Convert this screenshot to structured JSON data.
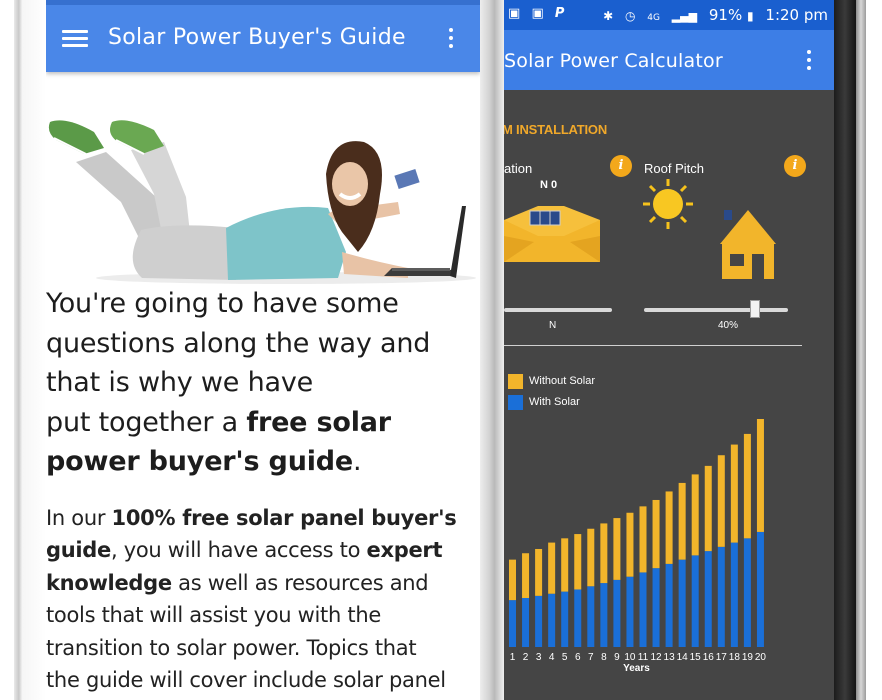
{
  "left_app": {
    "title": "Solar Power Buyer's Guide",
    "lead": {
      "line1": "You're going to have some",
      "line2": "questions along the way and",
      "line3": "that is why we have",
      "line4_pre": "put together a ",
      "line4_bold": "free solar",
      "line5_bold": "power buyer's guide",
      "line5_post": "."
    },
    "body": {
      "p1_pre": "In our ",
      "p1_bold1": "100% free solar panel buyer's",
      "p1_bold2": "guide",
      "p1_mid": ", you will have access to ",
      "p1_bold3": "expert",
      "p1_bold4": "knowledge",
      "p1_rest1": " as well as resources and",
      "p1_rest2": "tools that will assist you with the",
      "p1_rest3": "transition to solar power. Topics that",
      "p1_rest4": "the guide will cover include solar panel"
    }
  },
  "status_bar": {
    "left_icons": [
      "gallery-icon",
      "gallery-icon",
      "paypal-icon"
    ],
    "battery_percent": "91%",
    "time": "1:20 pm",
    "network": "4G"
  },
  "right_app": {
    "title": "Solar Power Calculator",
    "section_title": "M INSTALLATION",
    "orientation_label": "ation",
    "orientation_value": "N 0",
    "orientation_slider_label": "N",
    "roof_pitch_label": "Roof Pitch",
    "roof_pitch_value": "40%",
    "info_icon_text": "i",
    "legend": {
      "without_solar": "Without Solar",
      "with_solar": "With Solar"
    }
  },
  "colors": {
    "left_appbar": "#4a87e8",
    "right_appbar": "#3d7ee6",
    "status_bar": "#1a5fcf",
    "chart_background": "#454545",
    "without_solar": "#f2b52b",
    "with_solar": "#1a6fd8",
    "info_accent": "#f3a81b"
  },
  "chart_data": {
    "type": "bar",
    "stacked": true,
    "title": "",
    "xlabel": "Years",
    "ylabel": "",
    "categories": [
      "1",
      "2",
      "3",
      "4",
      "5",
      "6",
      "7",
      "8",
      "9",
      "10",
      "11",
      "12",
      "13",
      "14",
      "15",
      "16",
      "17",
      "18",
      "19",
      "20"
    ],
    "series": [
      {
        "name": "With Solar",
        "color": "#1a6fd8",
        "values": [
          44,
          46,
          48,
          50,
          52,
          54,
          57,
          60,
          63,
          66,
          70,
          74,
          78,
          82,
          86,
          90,
          94,
          98,
          102,
          108
        ]
      },
      {
        "name": "Without Solar",
        "color": "#f2b52b",
        "values": [
          38,
          42,
          44,
          48,
          50,
          52,
          54,
          56,
          58,
          60,
          62,
          64,
          68,
          72,
          76,
          80,
          86,
          92,
          98,
          106
        ]
      }
    ],
    "grid": false,
    "legend": "top-left"
  }
}
